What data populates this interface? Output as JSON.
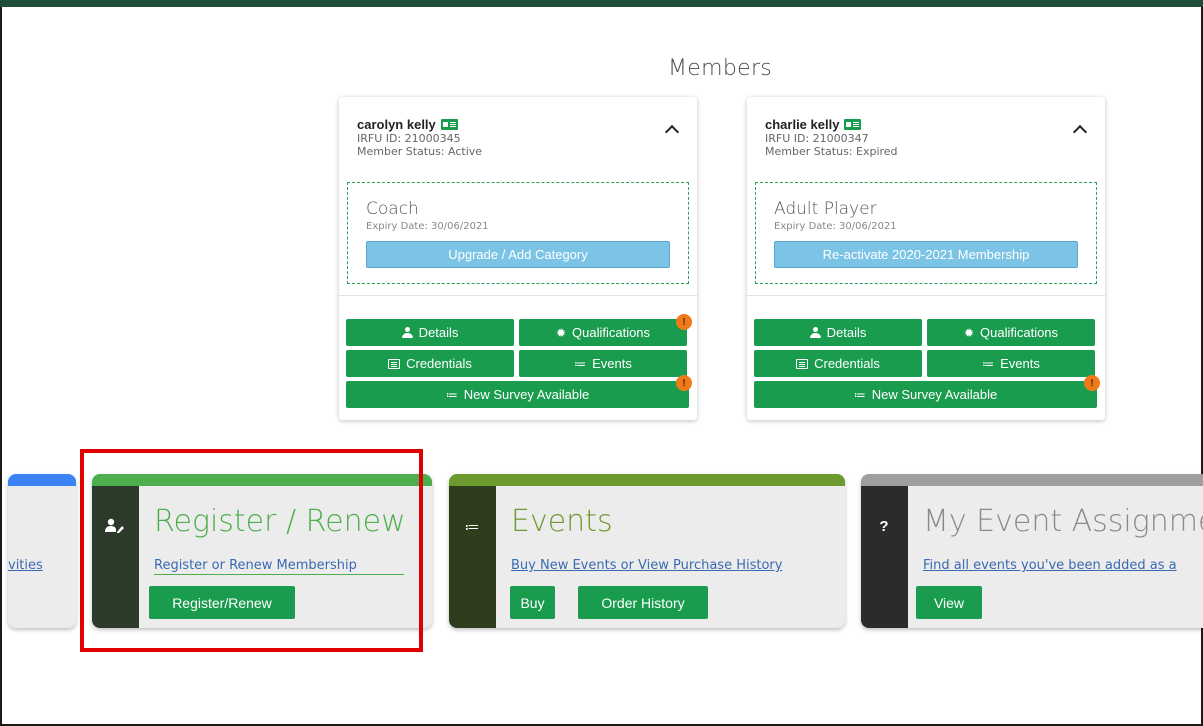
{
  "header": {
    "title": "Members"
  },
  "members": [
    {
      "name": "carolyn kelly",
      "irfu_id": "IRFU ID: 21000345",
      "status": "Member Status: Active",
      "category": "Coach",
      "expiry": "Expiry Date: 30/06/2021",
      "action": "Upgrade / Add Category",
      "buttons": {
        "details": "Details",
        "qualifications": "Qualifications",
        "credentials": "Credentials",
        "events": "Events",
        "survey": "New Survey Available"
      },
      "badge_mark": "!"
    },
    {
      "name": "charlie kelly",
      "irfu_id": "IRFU ID: 21000347",
      "status": "Member Status: Expired",
      "category": "Adult Player",
      "expiry": "Expiry Date: 30/06/2021",
      "action": "Re-activate 2020-2021 Membership",
      "buttons": {
        "details": "Details",
        "qualifications": "Qualifications",
        "credentials": "Credentials",
        "events": "Events",
        "survey": "New Survey Available"
      },
      "badge_mark": "!"
    }
  ],
  "tiles": {
    "partial": {
      "link": "vities"
    },
    "register": {
      "title": "Register / Renew",
      "link": "Register or Renew Membership",
      "button": "Register/Renew",
      "icon": "user-edit-icon"
    },
    "events": {
      "title": "Events",
      "link": "Buy New Events or View Purchase History",
      "buy": "Buy",
      "history": "Order History",
      "icon": "list-check-icon"
    },
    "assignments": {
      "title": "My Event Assignme",
      "link": "Find all events you've been added as a",
      "button": "View",
      "icon": "question-icon",
      "icon_char": "?"
    }
  },
  "colors": {
    "brand_green": "#1a9c4f",
    "topbar": "#1f4d3a",
    "highlight": "#e00000",
    "badge": "#f07a1a",
    "info_blue": "#7cc4e6"
  },
  "icons": {
    "list": "≔",
    "gear": "✹"
  }
}
